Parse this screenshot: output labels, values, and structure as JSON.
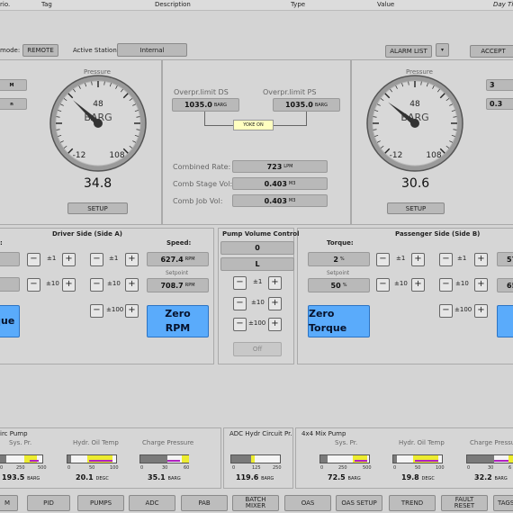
{
  "table_header": {
    "col1": "rio.",
    "col2": "Tag",
    "col3": "Description",
    "col4": "Type",
    "col5": "Value",
    "col6": "Day Ti"
  },
  "toolbar": {
    "mode_label": "mode:",
    "mode_value": "REMOTE",
    "station_label": "Active Station:",
    "station_value": "Internal",
    "alarm_list": "ALARM LIST",
    "accept": "ACCEPT"
  },
  "left_gauge": {
    "title": "Pressure",
    "unit": "BARG",
    "top": "48",
    "left": "-12",
    "right": "108",
    "value": "34.8",
    "setup": "SETUP",
    "needle_value": 27
  },
  "right_gauge": {
    "title": "Pressure",
    "unit": "BARG",
    "top": "48",
    "left": "-12",
    "right": "108",
    "value": "30.6",
    "setup": "SETUP",
    "needle_value": 25
  },
  "right_stubs": {
    "a": "3",
    "b": "0.3"
  },
  "center": {
    "ds_label": "Overpr.limit DS",
    "ds_value": "1035.0",
    "ds_unit": "BARG",
    "ps_label": "Overpr.limit PS",
    "ps_value": "1035.0",
    "ps_unit": "BARG",
    "yoke": "YOKE ON",
    "rate_label": "Combined Rate:",
    "rate_value": "723",
    "rate_unit": "LPM",
    "stage_label": "Comb Stage Vol:",
    "stage_value": "0.403",
    "stage_unit": "M3",
    "job_label": "Comb Job Vol:",
    "job_value": "0.403",
    "job_unit": "M3"
  },
  "driver": {
    "title": "Driver Side (Side A)",
    "torque_label": ":",
    "speed_label": "Speed:",
    "speed_value": "627.4",
    "speed_unit": "RPM",
    "setpoint_label": "Setpoint",
    "setpoint_value": "708.7",
    "setpoint_unit": "RPM",
    "step1": "±1",
    "step10": "±10",
    "step100": "±100",
    "zero_torque": "rque",
    "zero_rpm_1": "Zero",
    "zero_rpm_2": "RPM"
  },
  "pump": {
    "title": "Pump Volume Control",
    "value": "0",
    "unit": "L",
    "step1": "±1",
    "step10": "±10",
    "step100": "±100",
    "off": "Off"
  },
  "passenger": {
    "title": "Passenger Side (Side B)",
    "torque_label": "Torque:",
    "torque_value": "2",
    "torque_unit": "%",
    "setpoint_label": "Setpoint",
    "setpoint_value": "50",
    "setpoint_unit": "%",
    "step1": "±1",
    "step10": "±10",
    "step100": "±100",
    "zero_torque": "Zero Torque",
    "speed_stub": "57",
    "setpoint_stub": "65"
  },
  "bottom": {
    "circ_title": "irc Pump",
    "circ_sys": "Sys. Pr.",
    "circ_sys_ticks": [
      "0",
      "250",
      "500"
    ],
    "circ_sys_val": "193.5",
    "circ_sys_unit": "BARG",
    "circ_oil": "Hydr. Oil Temp",
    "circ_oil_ticks": [
      "0",
      "50",
      "100"
    ],
    "circ_oil_val": "20.1",
    "circ_oil_unit": "DEGC",
    "circ_charge": "Charge Pressure",
    "circ_charge_ticks": [
      "0",
      "30",
      "60"
    ],
    "circ_charge_val": "35.1",
    "circ_charge_unit": "BARG",
    "adc_title": "ADC Hydr Circuit Pr.",
    "adc_ticks": [
      "0",
      "125",
      "250"
    ],
    "adc_val": "119.6",
    "adc_unit": "BARG",
    "mix_title": "4x4 Mix Pump",
    "mix_sys": "Sys. Pr.",
    "mix_sys_ticks": [
      "0",
      "250",
      "500"
    ],
    "mix_sys_val": "72.5",
    "mix_sys_unit": "BARG",
    "mix_oil": "Hydr. Oil Temp",
    "mix_oil_ticks": [
      "0",
      "50",
      "100"
    ],
    "mix_oil_val": "19.8",
    "mix_oil_unit": "DEGC",
    "mix_charge": "Charge Pressure",
    "mix_charge_ticks": [
      "0",
      "30",
      "6"
    ],
    "mix_charge_val": "32.2",
    "mix_charge_unit": "BARG"
  },
  "nav": {
    "m": "M",
    "pid": "PID",
    "pumps": "PUMPS",
    "adc": "ADC",
    "pab": "PAB",
    "batch_1": "BATCH",
    "batch_2": "MIXER",
    "oas": "OAS",
    "oas_setup": "OAS SETUP",
    "trend": "TREND",
    "fault_1": "FAULT",
    "fault_2": "RESET",
    "tags": "TAGS"
  },
  "colors": {
    "accent_blue": "#5aabfb",
    "gauge_yellow": "#ecec30",
    "marker_magenta": "#b020c0",
    "yoke_bg": "#ffffc0"
  }
}
